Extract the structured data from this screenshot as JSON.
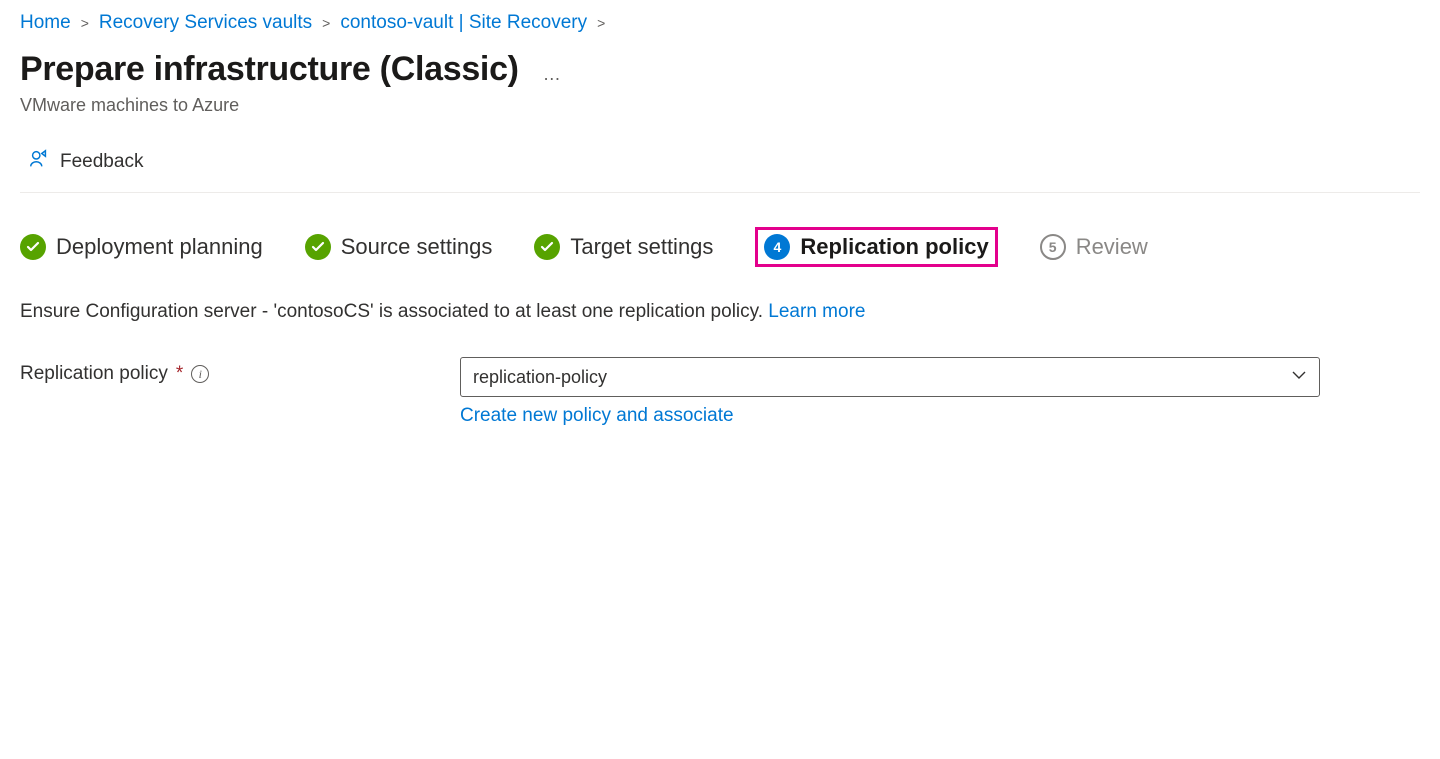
{
  "breadcrumb": {
    "items": [
      {
        "label": "Home"
      },
      {
        "label": "Recovery Services vaults"
      },
      {
        "label": "contoso-vault | Site Recovery"
      }
    ],
    "separator": ">"
  },
  "page": {
    "title": "Prepare infrastructure (Classic)",
    "subtitle": "VMware machines to Azure",
    "more": "…"
  },
  "toolbar": {
    "feedback_label": "Feedback"
  },
  "steps": [
    {
      "label": "Deployment planning",
      "state": "done"
    },
    {
      "label": "Source settings",
      "state": "done"
    },
    {
      "label": "Target settings",
      "state": "done"
    },
    {
      "label": "Replication policy",
      "state": "active",
      "num": "4"
    },
    {
      "label": "Review",
      "state": "inactive",
      "num": "5"
    }
  ],
  "description": {
    "text": "Ensure Configuration server - 'contosoCS' is associated to at least one replication policy. ",
    "learn_more": "Learn more"
  },
  "form": {
    "policy_label": "Replication policy",
    "policy_value": "replication-policy",
    "create_link": "Create new policy and associate"
  }
}
